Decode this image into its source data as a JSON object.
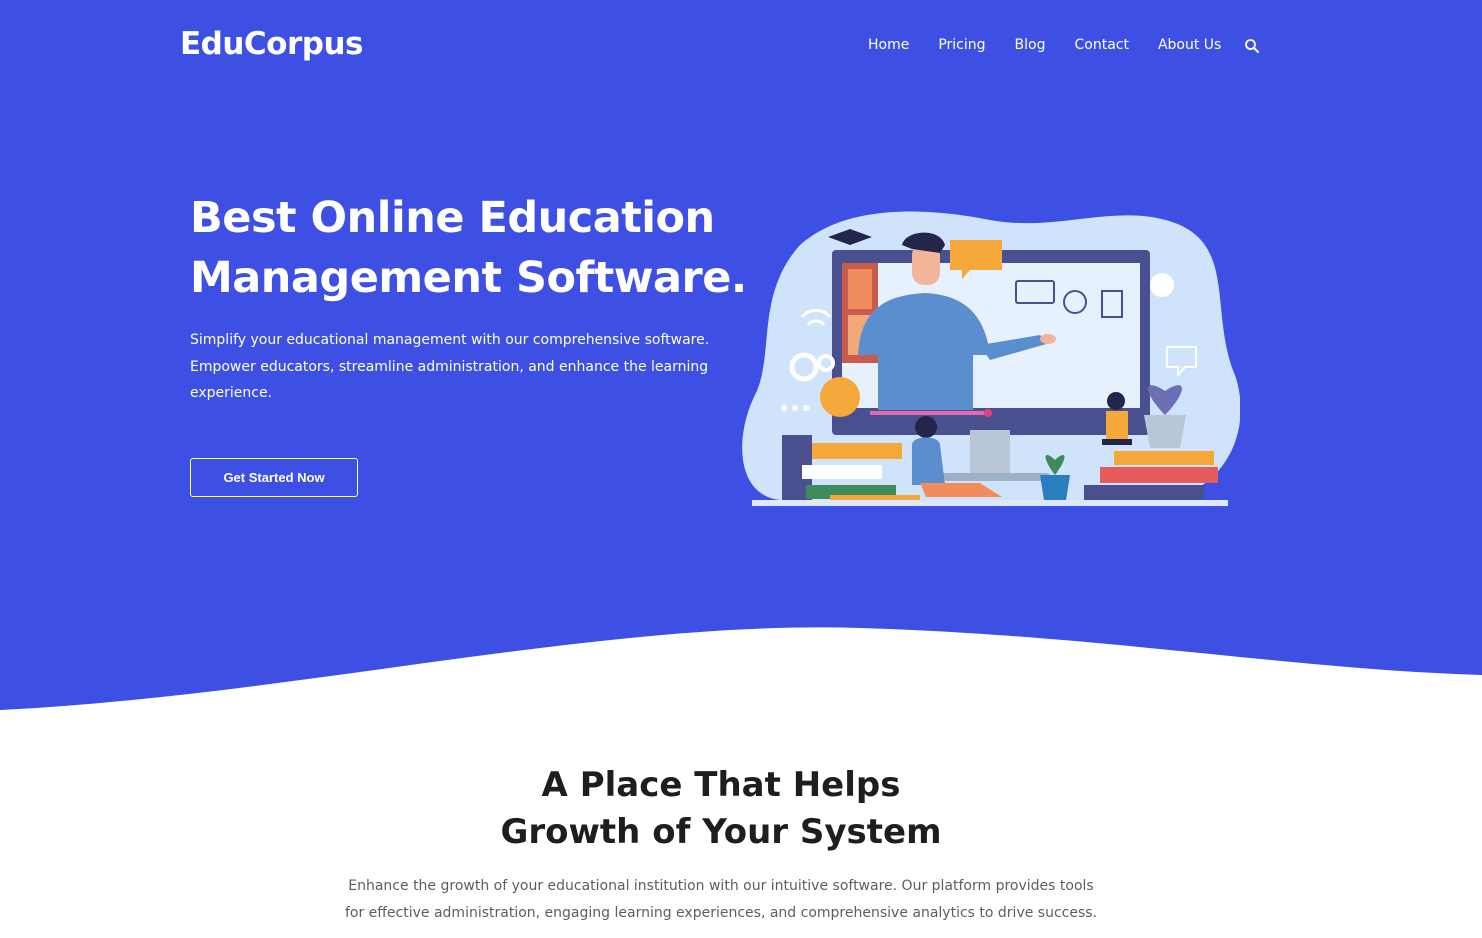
{
  "brand": {
    "name": "EduCorpus",
    "accent": "#3d50e3"
  },
  "nav": {
    "items": [
      "Home",
      "Pricing",
      "Blog",
      "Contact",
      "About Us"
    ],
    "search_icon": "search-icon"
  },
  "hero": {
    "title_line1": "Best Online Education",
    "title_line2": "Management Software.",
    "description": "Simplify your educational management with our comprehensive software. Empower educators, streamline administration, and enhance the learning experience.",
    "cta_label": "Get Started Now"
  },
  "section": {
    "title_line1": "A Place That Helps",
    "title_line2": "Growth of Your System",
    "description": "Enhance the growth of your educational institution with our intuitive software. Our platform provides tools for effective administration, engaging learning experiences, and comprehensive analytics to drive success."
  }
}
